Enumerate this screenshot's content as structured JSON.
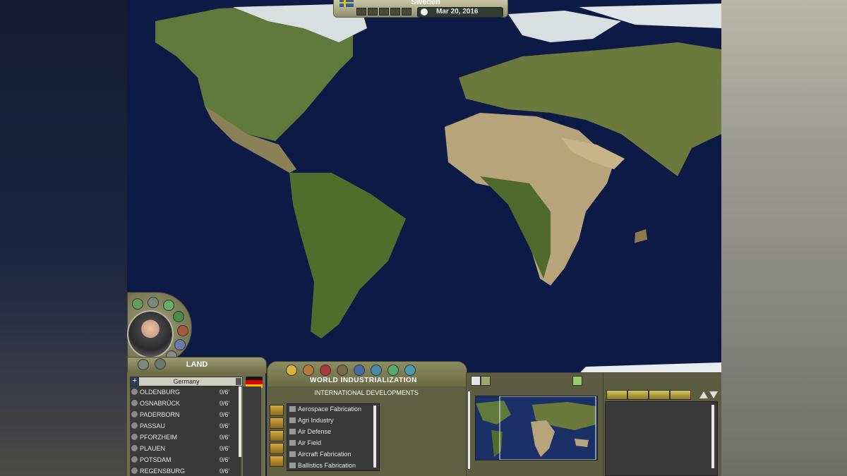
{
  "topbar": {
    "country": "Sweden",
    "date": "Mar 20, 2016"
  },
  "land_panel": {
    "title": "LAND",
    "country_select": "Germany",
    "plus_label": "+",
    "cities": [
      {
        "name": "OLDENBURG",
        "value": "0/6'"
      },
      {
        "name": "OSNABRÜCK",
        "value": "0/6'"
      },
      {
        "name": "PADERBORN",
        "value": "0/6'"
      },
      {
        "name": "PASSAU",
        "value": "0/6'"
      },
      {
        "name": "PFORZHEIM",
        "value": "0/6'"
      },
      {
        "name": "PLAUEN",
        "value": "0/6'"
      },
      {
        "name": "POTSDAM",
        "value": "0/6'"
      },
      {
        "name": "REGENSBURG",
        "value": "0/6'"
      }
    ]
  },
  "industrialization_panel": {
    "title": "WORLD INDUSTRIALIZATION",
    "header": "INTERNATIONAL DEVELOPMENTS",
    "developments": [
      "Aerospace Fabrication",
      "Agri Industry",
      "Air Defense",
      "Air Field",
      "Aircraft Fabrication",
      "Ballistics Fabrication"
    ]
  },
  "colors": {
    "ocean": "#0d1a46",
    "panel": "#79794e",
    "panel_dark": "#5c5c40",
    "list_bg": "#3a3a3a"
  }
}
